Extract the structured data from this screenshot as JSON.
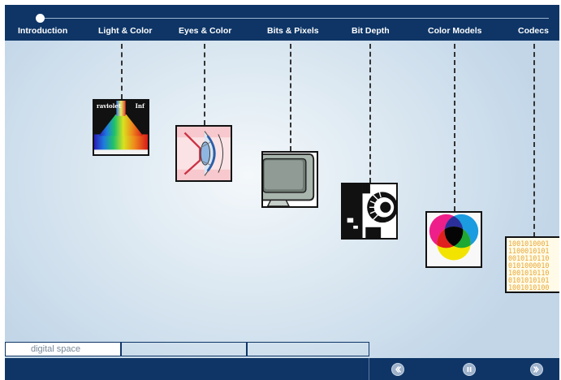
{
  "timeline": {
    "position_index": 0,
    "sections": [
      {
        "label": "Introduction"
      },
      {
        "label": "Light & Color",
        "thumb_left_text": "raviolet",
        "thumb_right_text": "Inf"
      },
      {
        "label": "Eyes & Color"
      },
      {
        "label": "Bits & Pixels"
      },
      {
        "label": "Bit Depth"
      },
      {
        "label": "Color Models"
      },
      {
        "label": "Codecs",
        "thumb_bits": [
          "1001010001",
          "1100010101",
          "0010110110",
          "0101000010",
          "1001010110",
          "0101010101",
          "1001010100"
        ]
      }
    ]
  },
  "tabs": [
    {
      "label": "digital space"
    },
    {
      "label": ""
    },
    {
      "label": ""
    }
  ],
  "controls": {
    "back_icon": "chevron-left-icon",
    "pause_icon": "pause-icon",
    "forward_icon": "chevron-right-icon"
  },
  "colors": {
    "bar": "#0e3566",
    "code_digits": "#e8a838"
  }
}
